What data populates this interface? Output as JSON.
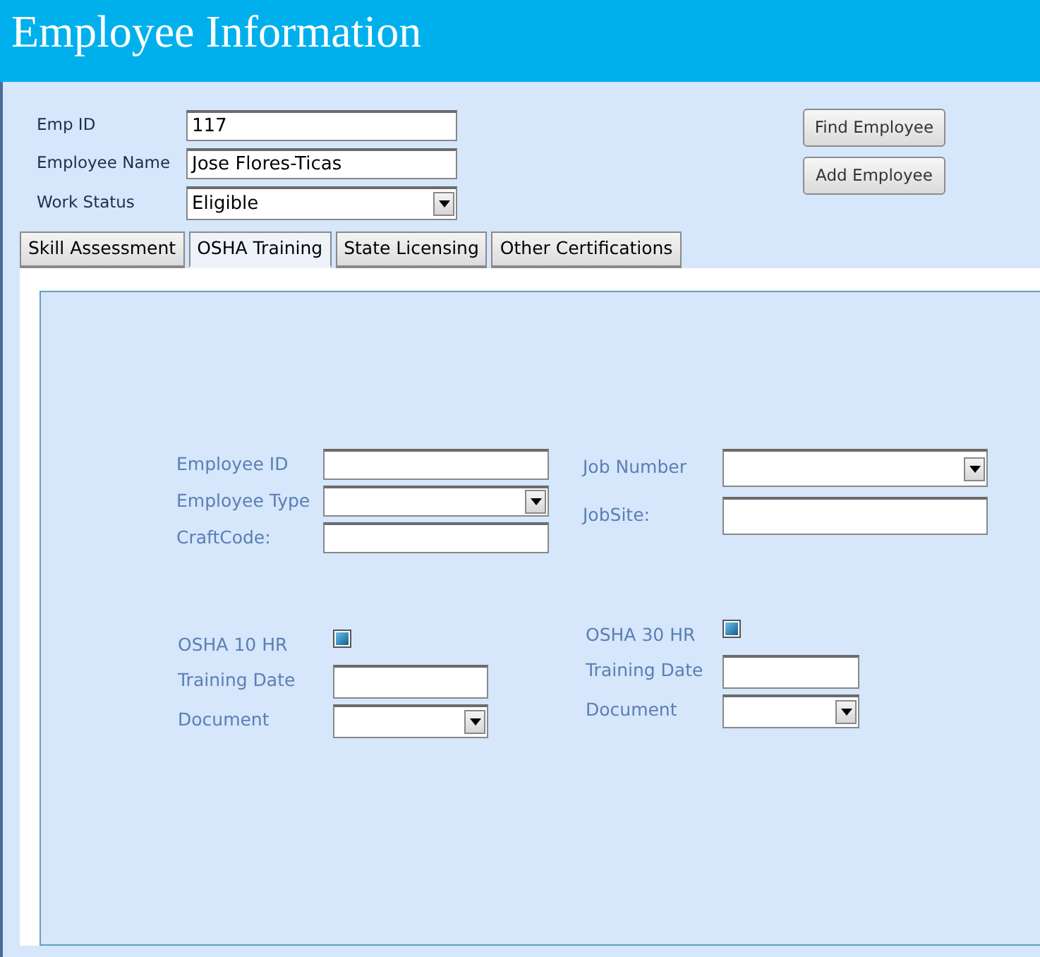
{
  "window": {
    "title": "Employee Information"
  },
  "header_fields": [
    {
      "label": "Emp ID",
      "kind": "text",
      "value": "117"
    },
    {
      "label": "Employee Name",
      "kind": "text",
      "value": "Jose Flores-Ticas"
    },
    {
      "label": "Work Status",
      "kind": "combo",
      "value": "Eligible"
    }
  ],
  "buttons": [
    "Find Employee",
    "Add Employee"
  ],
  "tabs": [
    {
      "label": "Skill Assessment",
      "selected": false
    },
    {
      "label": "OSHA Training",
      "selected": true
    },
    {
      "label": "State Licensing",
      "selected": false
    },
    {
      "label": "Other Certifications",
      "selected": false
    }
  ],
  "employee_left": [
    {
      "label": "Employee ID",
      "kind": "text"
    },
    {
      "label": "Employee Type",
      "kind": "combo"
    },
    {
      "label": "CraftCode:",
      "kind": "text"
    }
  ],
  "employee_right": [
    {
      "label": "Job Number",
      "kind": "combo"
    },
    {
      "label": "JobSite:",
      "kind": "text"
    }
  ],
  "osha": [
    {
      "fields": [
        {
          "label": "OSHA 10 HR",
          "kind": "check",
          "indeterminate": true
        },
        {
          "label": "Training Date",
          "kind": "text"
        },
        {
          "label": "Document",
          "kind": "combo"
        }
      ]
    },
    {
      "fields": [
        {
          "label": "OSHA 30 HR",
          "kind": "check",
          "indeterminate": true
        },
        {
          "label": "Training Date",
          "kind": "text"
        },
        {
          "label": "Document",
          "kind": "combo"
        }
      ]
    }
  ]
}
